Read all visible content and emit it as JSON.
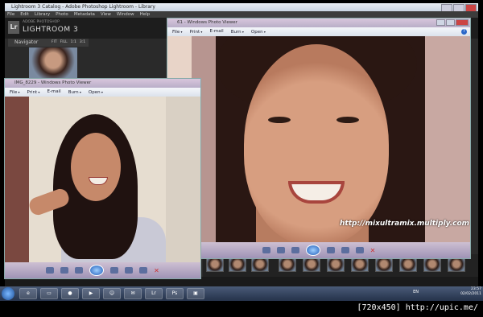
{
  "lightroom": {
    "window_title": "Lightroom 3 Catalog - Adobe Photoshop Lightroom - Library",
    "menu": [
      "File",
      "Edit",
      "Library",
      "Photo",
      "Metadata",
      "View",
      "Window",
      "Help"
    ],
    "brand_sub": "ADOBE PHOTOSHOP",
    "brand_name": "LIGHTROOM 3",
    "logo": "Lr",
    "navigator_label": "Navigator",
    "navigator_zoom": [
      "FIT",
      "FILL",
      "1:1",
      "3:1"
    ]
  },
  "viewer_main": {
    "title": "61 - Windows Photo Viewer",
    "menu": [
      "File",
      "Print",
      "E-mail",
      "Burn",
      "Open"
    ],
    "watermark": "http://mixultramix.multiply.com"
  },
  "viewer_small": {
    "title": "IMG_8229 - Windows Photo Viewer",
    "menu": [
      "File",
      "Print",
      "E-mail",
      "Burn",
      "Open"
    ]
  },
  "taskbar": {
    "apps": [
      "ie-icon",
      "folder-icon",
      "firefox-icon",
      "media-player-icon",
      "messenger-icon",
      "gtalk-icon",
      "lightroom-icon",
      "photoshop-icon",
      "photo-viewer-icon"
    ],
    "lr_label": "Lr",
    "ps_label": "Ps",
    "lang": "EN",
    "time": "23:57",
    "date": "02/02/2011"
  },
  "credit": "[720x450] http://upic.me/"
}
